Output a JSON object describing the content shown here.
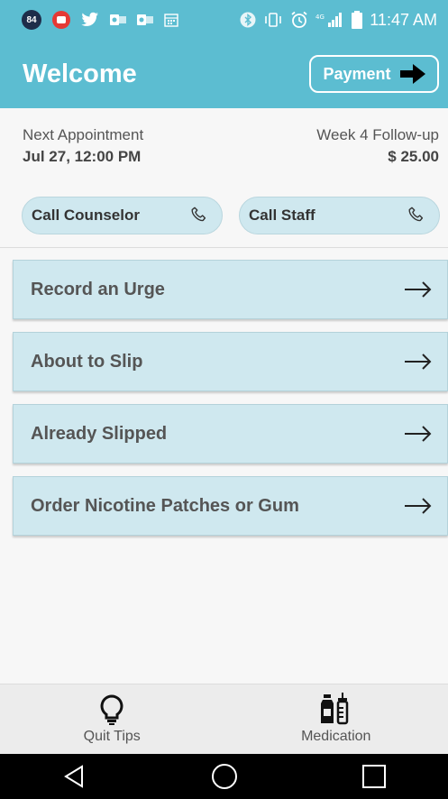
{
  "status_bar": {
    "notification_count": "84",
    "time": "11:47 AM",
    "icons": [
      "badge-icon",
      "youtube-icon",
      "twitter-icon",
      "outlook-icon",
      "outlook-icon",
      "calendar-icon",
      "bluetooth-icon",
      "vibrate-icon",
      "alarm-icon",
      "signal-icon",
      "battery-icon"
    ]
  },
  "header": {
    "title": "Welcome",
    "payment_label": "Payment"
  },
  "appointment": {
    "label": "Next Appointment",
    "datetime": "Jul 27, 12:00 PM",
    "type": "Week 4 Follow-up",
    "amount": "$ 25.00"
  },
  "call_buttons": [
    {
      "label": "Call Counselor",
      "icon": "phone-icon"
    },
    {
      "label": "Call Staff",
      "icon": "phone-icon"
    }
  ],
  "actions": [
    {
      "label": "Record an Urge",
      "icon": "arrow-right-icon"
    },
    {
      "label": "About to Slip",
      "icon": "arrow-right-icon"
    },
    {
      "label": "Already Slipped",
      "icon": "arrow-right-icon"
    },
    {
      "label": "Order Nicotine Patches or Gum",
      "icon": "arrow-right-icon"
    }
  ],
  "tabs": [
    {
      "label": "Quit Tips",
      "icon": "lightbulb-icon"
    },
    {
      "label": "Medication",
      "icon": "medication-icon"
    }
  ],
  "nav": {
    "icons": [
      "back-icon",
      "home-icon",
      "recents-icon"
    ]
  },
  "colors": {
    "primary": "#5cbdd1",
    "button_bg": "#cfe8ef"
  }
}
